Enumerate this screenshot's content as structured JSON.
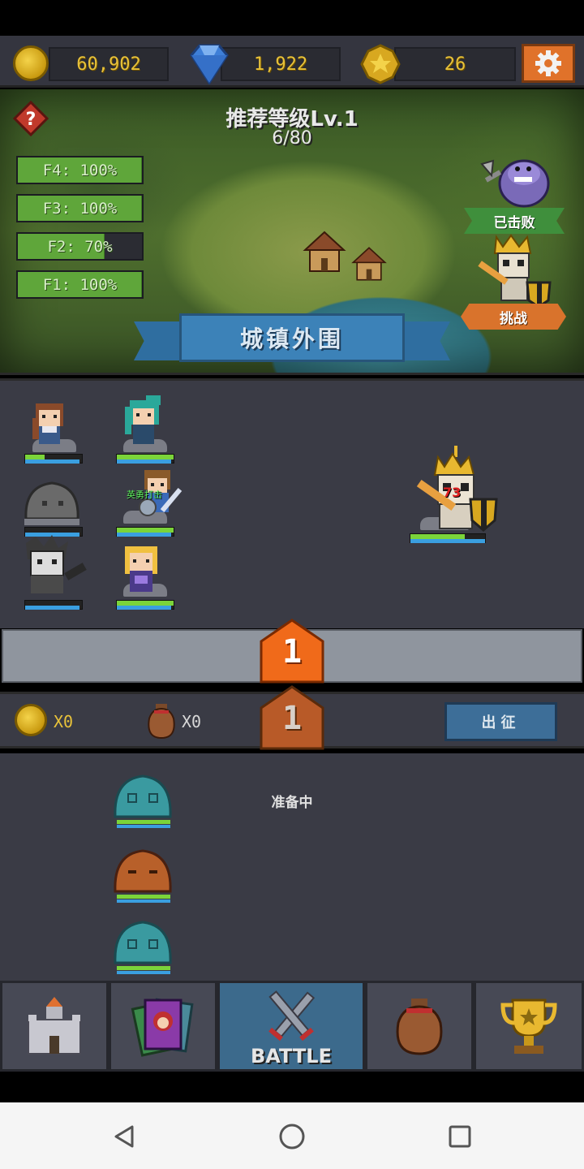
{
  "currency": {
    "gold": "60,902",
    "diamonds": "1,922",
    "medals": "26"
  },
  "stage": {
    "recommended_level": "推荐等级Lv.1",
    "progress": "6/80",
    "name": "城镇外围",
    "defeated_label": "已击败",
    "challenge_label": "挑战",
    "floors": [
      {
        "label": "F4: 100%",
        "percent": 100
      },
      {
        "label": "F3: 100%",
        "percent": 100
      },
      {
        "label": "F2: 70%",
        "percent": 70
      },
      {
        "label": "F1: 100%",
        "percent": 100
      }
    ]
  },
  "battle": {
    "damage_number": "73",
    "buff_label": "英勇打击",
    "wave_current": "1",
    "wave_next": "1",
    "team_hp": [
      {
        "hp": 0.34,
        "mp": 0.95
      },
      {
        "hp": 1.0,
        "mp": 0.95
      },
      {
        "hp": 0.0,
        "mp": 0.95
      },
      {
        "hp": 1.0,
        "mp": 0.95
      },
      {
        "hp": 0.0,
        "mp": 0.95
      },
      {
        "hp": 1.0,
        "mp": 0.95
      }
    ],
    "boss_hp": {
      "hp": 0.73,
      "mp": 1.0
    }
  },
  "rewards": {
    "gold_count": "X0",
    "bag_count": "X0",
    "depart_label": "出征"
  },
  "queue": {
    "status": "准备中"
  },
  "nav": {
    "battle_label": "BATTLE"
  },
  "colors": {
    "gold_text": "#e8c23a",
    "settings_bg": "#e0722a",
    "wave_badge": "#f06a1a",
    "active_tab": "#3c6a8c"
  },
  "icons": [
    "coin-icon",
    "diamond-icon",
    "medal-icon",
    "gear-icon",
    "help-icon",
    "castle-icon",
    "hero-cards-icon",
    "crossed-swords-icon",
    "loot-bag-icon",
    "trophy-icon",
    "back-icon",
    "home-icon",
    "recents-icon"
  ]
}
